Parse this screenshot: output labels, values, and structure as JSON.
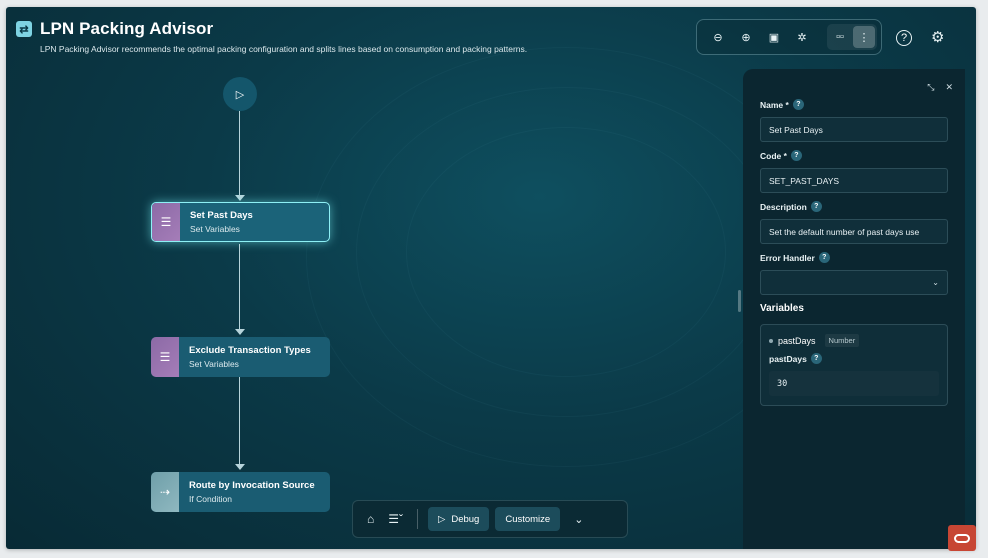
{
  "header": {
    "title": "LPN Packing Advisor",
    "subtitle": "LPN Packing Advisor recommends the optimal packing configuration and splits lines based on consumption and packing patterns."
  },
  "toolbar": {
    "icons": [
      "zoom-out-icon",
      "zoom-in-icon",
      "fit-icon",
      "center-icon",
      "horizontal-layout-icon",
      "vertical-layout-icon",
      "help-icon",
      "settings-icon"
    ]
  },
  "flow": {
    "nodes": [
      {
        "title": "Set Past Days",
        "subtitle": "Set Variables",
        "icon": "set-variables-icon",
        "selected": true
      },
      {
        "title": "Exclude Transaction Types",
        "subtitle": "Set Variables",
        "icon": "set-variables-icon",
        "selected": false
      },
      {
        "title": "Route by Invocation Source",
        "subtitle": "If Condition",
        "icon": "route-icon",
        "selected": false
      }
    ]
  },
  "bottom_bar": {
    "debug_label": "Debug",
    "customize_label": "Customize"
  },
  "panel": {
    "name_label": "Name *",
    "name_value": "Set Past Days",
    "code_label": "Code *",
    "code_value": "SET_PAST_DAYS",
    "description_label": "Description",
    "description_value": "Set the default number of past days use",
    "error_handler_label": "Error Handler",
    "error_handler_value": "",
    "variables_heading": "Variables",
    "variable": {
      "name": "pastDays",
      "type": "Number",
      "label": "pastDays",
      "value": "30"
    }
  },
  "colors": {
    "canvas": "#0b3a48",
    "node": "#1a5c72",
    "selected_glow": "#8ef0f5",
    "brand": "#c74634"
  }
}
